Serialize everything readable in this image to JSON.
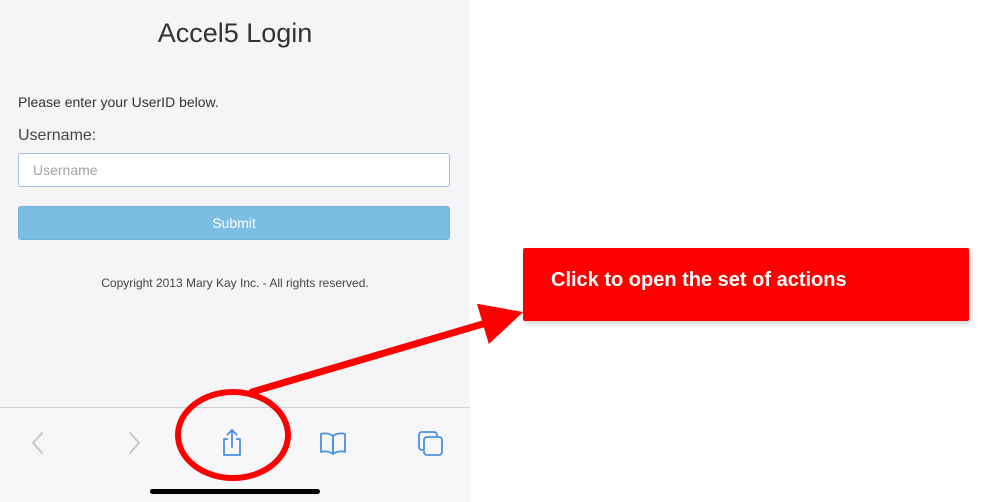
{
  "page": {
    "title": "Accel5 Login",
    "prompt": "Please enter your UserID below.",
    "username_label": "Username:",
    "username_value": "",
    "username_placeholder": "Username",
    "submit_label": "Submit",
    "copyright": "Copyright 2013 Mary Kay Inc. - All rights reserved."
  },
  "toolbar": {
    "items": [
      {
        "icon": "chevron-left-icon",
        "enabled": false
      },
      {
        "icon": "chevron-right-icon",
        "enabled": false
      },
      {
        "icon": "share-icon",
        "enabled": true
      },
      {
        "icon": "book-icon",
        "enabled": true
      },
      {
        "icon": "tabs-icon",
        "enabled": true
      }
    ]
  },
  "annotation": {
    "callout_text": "Click to open the set of actions",
    "color": "#fe0000"
  },
  "colors": {
    "accent": "#4a90e2",
    "submit": "#7cbde3",
    "disabled": "#c7c7cc"
  }
}
